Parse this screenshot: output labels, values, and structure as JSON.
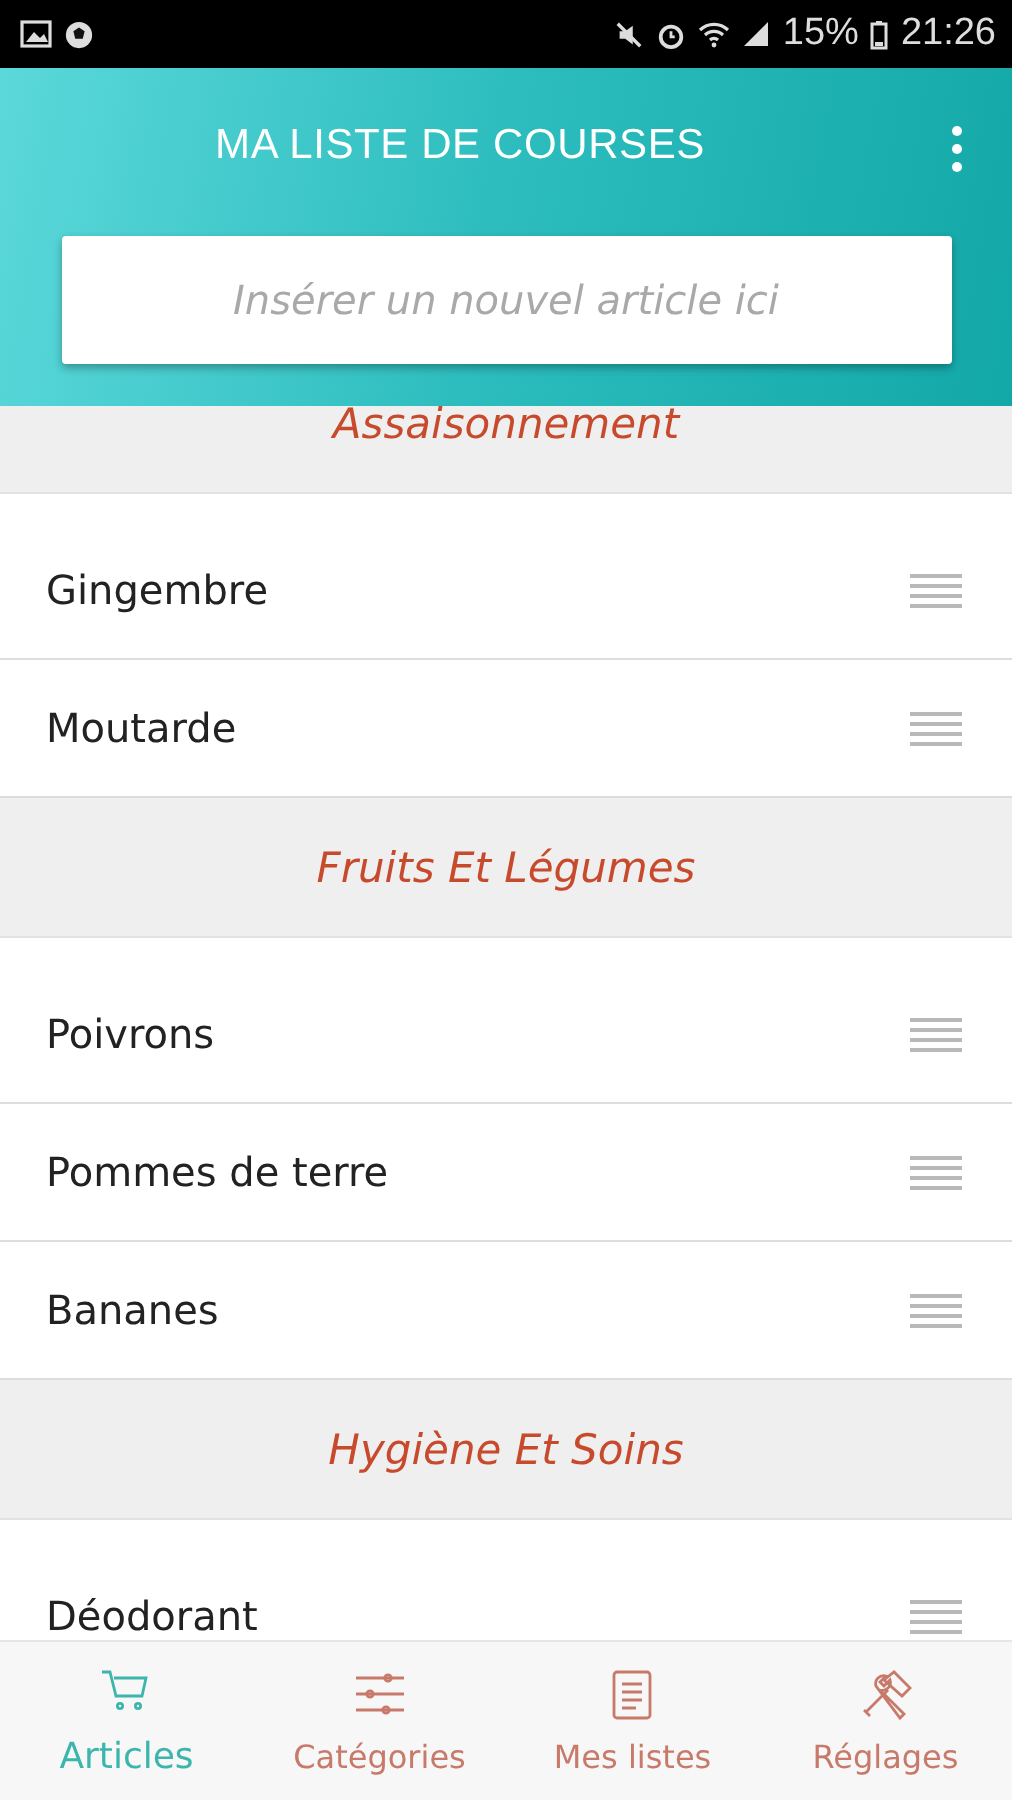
{
  "status_bar": {
    "battery": "15%",
    "time": "21:26"
  },
  "header": {
    "title": "MA LISTE DE COURSES"
  },
  "new_item": {
    "placeholder": "Insérer un nouvel article ici"
  },
  "sections": [
    {
      "title": "Assaisonnement",
      "items": [
        "Gingembre",
        "Moutarde"
      ]
    },
    {
      "title": "Fruits Et Légumes",
      "items": [
        "Poivrons",
        "Pommes de terre",
        "Bananes"
      ]
    },
    {
      "title": "Hygiène Et Soins",
      "items": [
        "Déodorant"
      ]
    }
  ],
  "nav": [
    {
      "kind": "cart",
      "label": "Articles",
      "selected": true
    },
    {
      "kind": "sliders",
      "label": "Catégories",
      "selected": false
    },
    {
      "kind": "list",
      "label": "Mes listes",
      "selected": false
    },
    {
      "kind": "tools",
      "label": "Réglages",
      "selected": false
    }
  ]
}
